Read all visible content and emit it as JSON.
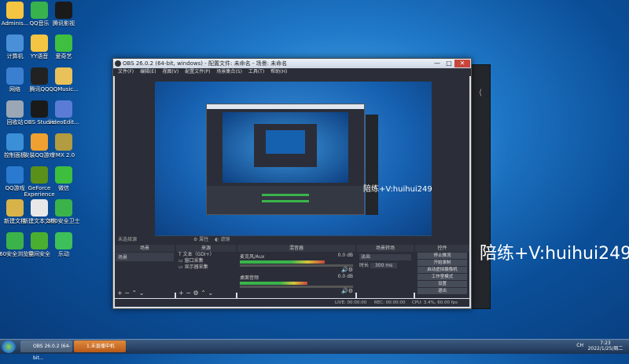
{
  "desktop": {
    "icons": [
      {
        "label": "Adminis...",
        "color": "#f4c542"
      },
      {
        "label": "QQ音乐",
        "color": "#37b24d"
      },
      {
        "label": "腾讯影视",
        "color": "#1a1a1a"
      },
      {
        "label": "计算机",
        "color": "#4a90d9"
      },
      {
        "label": "YY语音",
        "color": "#f4c542"
      },
      {
        "label": "爱奇艺",
        "color": "#3fbf3f"
      },
      {
        "label": "网络",
        "color": "#3b7fd1"
      },
      {
        "label": "腾讯QQ",
        "color": "#222222"
      },
      {
        "label": "QQMusic...",
        "color": "#e8c15a"
      },
      {
        "label": "回收站",
        "color": "#9aa7b5"
      },
      {
        "label": "OBS Studio",
        "color": "#1a1a1a"
      },
      {
        "label": "videoEdit...",
        "color": "#5a7cd6"
      },
      {
        "label": "控制面板",
        "color": "#3b8fd6"
      },
      {
        "label": "安装QQ游戏",
        "color": "#f0a030"
      },
      {
        "label": "FMX 2.0",
        "color": "#b29b40"
      },
      {
        "label": "QQ游戏",
        "color": "#2a7ad0"
      },
      {
        "label": "GeForce Experience",
        "color": "#5a8f1a"
      },
      {
        "label": "微信",
        "color": "#3dbf3d"
      },
      {
        "label": "新建文档",
        "color": "#d8b34a"
      },
      {
        "label": "新建文本文档",
        "color": "#e8e8e8"
      },
      {
        "label": "360安全卫士",
        "color": "#3cb34a"
      },
      {
        "label": "360安全浏览器",
        "color": "#3cb34a"
      },
      {
        "label": "空间安全",
        "color": "#4aaf30"
      },
      {
        "label": "乐动",
        "color": "#3dbf5a"
      }
    ]
  },
  "obs": {
    "title": "OBS 26.0.2 (64-bit, windows) - 配置文件: 未命名 - 场景: 未命名",
    "menu": [
      "文件(F)",
      "编辑(E)",
      "视图(V)",
      "配置文件(P)",
      "场景集合(S)",
      "工具(T)",
      "帮助(H)"
    ],
    "overlay_text": "陪练+V:huihui249",
    "dock_title": "未选择源",
    "dock_props": "属性",
    "dock_filters": "滤镜",
    "scenes": {
      "header": "场景",
      "items": [
        "场景"
      ]
    },
    "sources": {
      "header": "来源",
      "items": [
        {
          "label": "文本（GDI+）",
          "icon": "T"
        },
        {
          "label": "窗口采集",
          "icon": "▭"
        },
        {
          "label": "显示器采集",
          "icon": "▭"
        }
      ]
    },
    "mixer": {
      "header": "混音器",
      "tracks": [
        {
          "name": "麦克风/Aux",
          "db": "0.0 dB",
          "level": 0.75
        },
        {
          "name": "桌面音频",
          "db": "0.0 dB",
          "level": 0.6
        }
      ]
    },
    "transitions": {
      "header": "场景转场",
      "selected": "淡出",
      "duration_label": "时长",
      "duration_value": "300 ms"
    },
    "controls": {
      "header": "控件",
      "buttons": [
        "停止推流",
        "开始录制",
        "启动虚拟摄像机",
        "工作室模式",
        "设置",
        "退出"
      ]
    },
    "status": {
      "live": "LIVE: 00:00:00",
      "rec": "REC: 00:00:00",
      "cpu": "CPU: 3.4%, 60.00 fps"
    }
  },
  "external_overlay": "陪练+V:huihui249",
  "taskbar": {
    "items": [
      "OBS 26.0.2 (64-bit...",
      "1.未直播中机"
    ],
    "tray": "CH",
    "time": "7:23",
    "date": "2022/1/25/周二"
  }
}
